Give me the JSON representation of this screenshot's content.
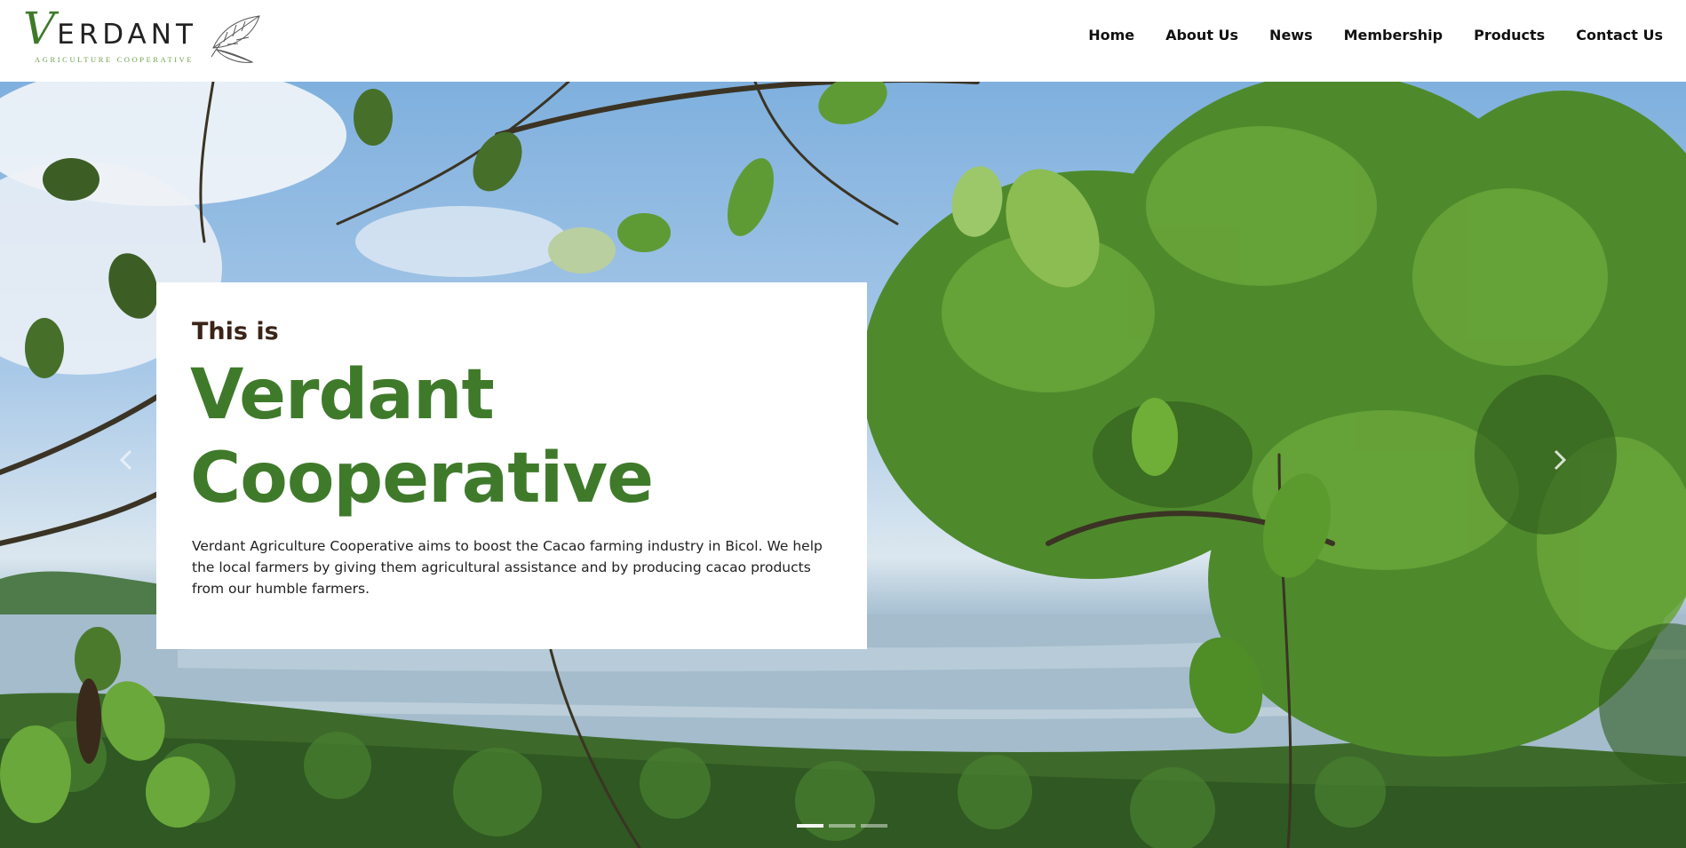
{
  "brand": {
    "logo_initial": "V",
    "logo_rest": "ERDANT",
    "tagline": "AGRICULTURE COOPERATIVE",
    "accent_color": "#3f7a2b",
    "eyebrow_color": "#3a2418"
  },
  "nav": {
    "items": [
      {
        "label": "Home"
      },
      {
        "label": "About Us"
      },
      {
        "label": "News"
      },
      {
        "label": "Membership"
      },
      {
        "label": "Products"
      },
      {
        "label": "Contact Us"
      }
    ]
  },
  "hero": {
    "eyebrow": "This is",
    "title_line1": "Verdant",
    "title_line2": "Cooperative",
    "description": "Verdant Agriculture Cooperative aims to boost the Cacao farming industry in Bicol. We help the local farmers by giving them agricultural assistance and by producing cacao products from our humble farmers.",
    "background_image": "tropical-forest-sea-view",
    "prev_icon": "chevron-left-icon",
    "next_icon": "chevron-right-icon",
    "slides": {
      "count": 3,
      "active_index": 0
    }
  }
}
